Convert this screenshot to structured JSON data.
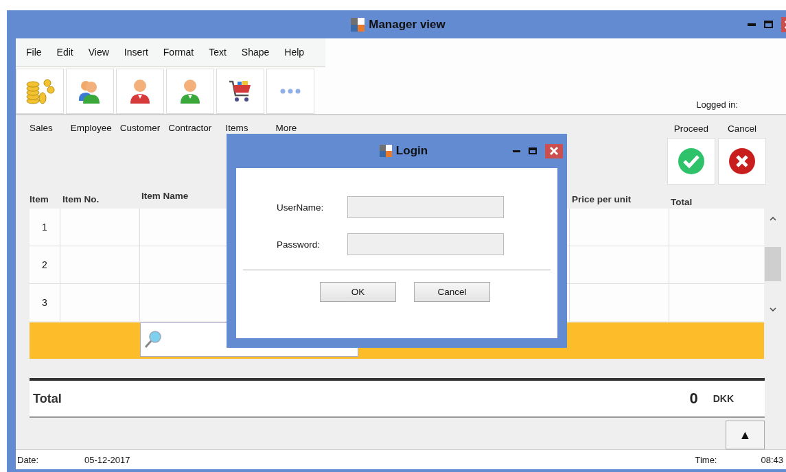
{
  "window": {
    "title": "Manager view"
  },
  "menu": [
    "File",
    "Edit",
    "View",
    "Insert",
    "Format",
    "Text",
    "Shape",
    "Help"
  ],
  "toolbar": [
    {
      "kind": "coins",
      "label": "Sales"
    },
    {
      "kind": "people",
      "label": "Employee"
    },
    {
      "kind": "person",
      "color": "#d63a3a",
      "label": "Customer"
    },
    {
      "kind": "person",
      "color": "#3aa83a",
      "label": "Contractor"
    },
    {
      "kind": "cart",
      "label": "Items"
    },
    {
      "kind": "more",
      "label": "More"
    }
  ],
  "logged_in": "Logged in:",
  "actions": [
    {
      "kind": "proceed",
      "label": "Proceed"
    },
    {
      "kind": "cancel",
      "label": "Cancel"
    }
  ],
  "table": {
    "columns": [
      "Item",
      "Item No.",
      "Item Name",
      "Price per unit",
      "Total"
    ],
    "rows": [
      "1",
      "2",
      "3"
    ]
  },
  "totals": {
    "label": "Total",
    "amount": "0",
    "currency": "DKK"
  },
  "scroll_up_button": "▲",
  "status_bar": {
    "date_label": "Date:",
    "date": "05-12-2017",
    "time_label": "Time:",
    "time": "08:43"
  },
  "dialog": {
    "title": "Login",
    "fields": [
      {
        "label": "UserName:"
      },
      {
        "label": "Password:"
      }
    ],
    "buttons": [
      "OK",
      "Cancel"
    ]
  }
}
